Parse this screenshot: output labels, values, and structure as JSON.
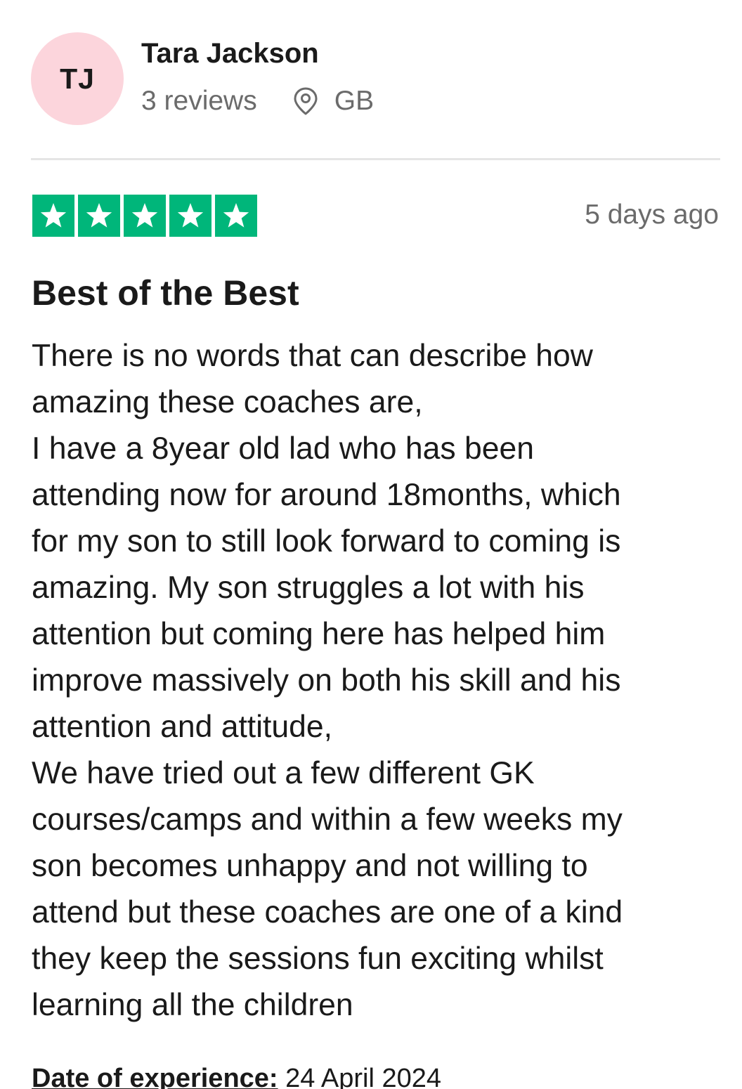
{
  "reviewer": {
    "initials": "TJ",
    "name": "Tara Jackson",
    "reviews_count": "3 reviews",
    "country": "GB",
    "avatar_color": "#fcd5dc"
  },
  "rating": {
    "stars": 5,
    "max": 5,
    "color": "#00b67a",
    "icon": "star-icon"
  },
  "review": {
    "posted": "5 days ago",
    "title": "Best of the Best",
    "body_lines": [
      "There is no words that can describe how",
      "amazing these coaches are,",
      "I have a 8year old lad who has been",
      "attending now for around 18months, which",
      "for my son to still look forward to coming is",
      "amazing. My son struggles a lot with his",
      "attention but coming here has helped him",
      "improve massively on both his skill and his",
      "attention and attitude,",
      "We have tried out a few different GK",
      "courses/camps and within a few weeks my",
      "son becomes unhappy and not willing to",
      "attend but these coaches are one of a kind",
      "they keep the sessions fun exciting whilst",
      "learning all the children"
    ],
    "experience_label": "Date of experience:",
    "experience_date": "24 April 2024"
  },
  "icons": {
    "location": "location-pin-icon"
  }
}
